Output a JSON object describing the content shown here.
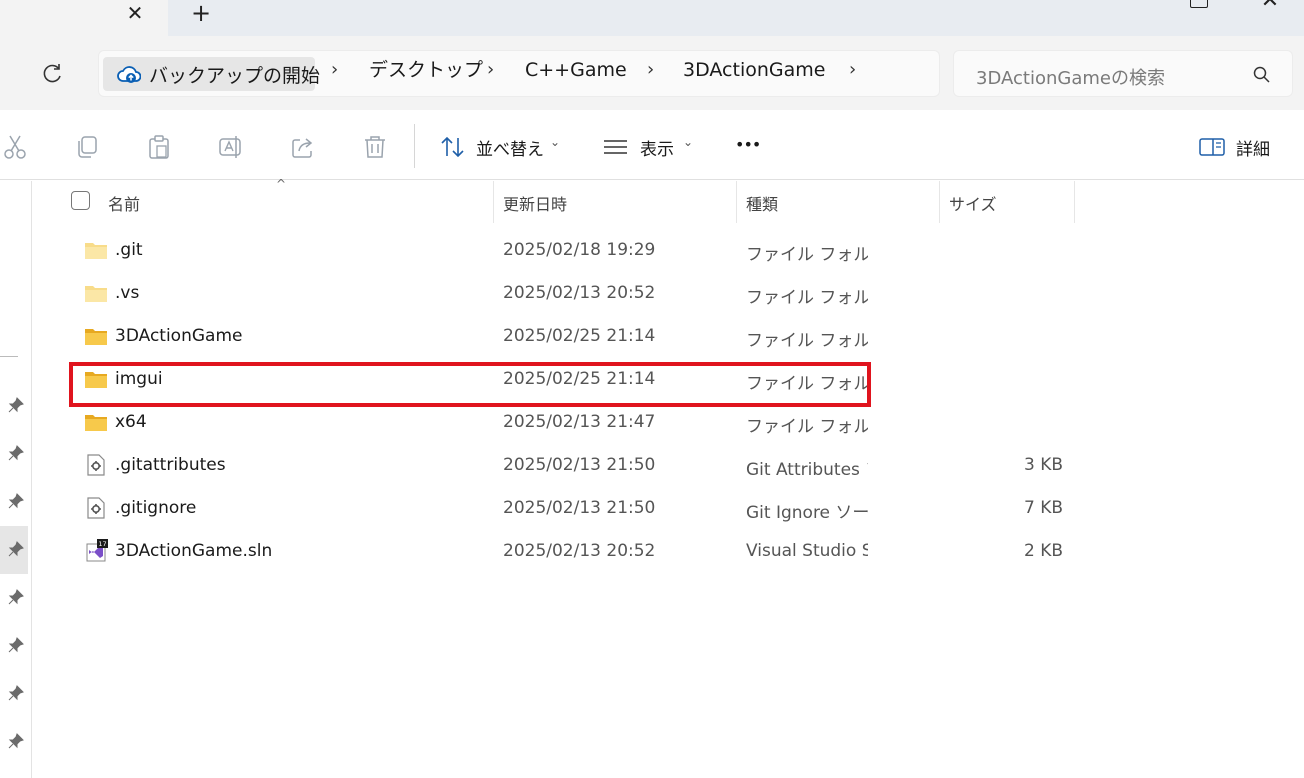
{
  "window": {
    "tab_close_glyph": "✕",
    "new_tab_glyph": "+",
    "close_glyph": "✕"
  },
  "address": {
    "breadcrumbs": [
      "バックアップの開始",
      "デスクトップ",
      "C++Game",
      "3DActionGame"
    ],
    "chevron": "›",
    "search_placeholder": "3DActionGameの検索"
  },
  "toolbar": {
    "sort_label": "並べ替え",
    "view_label": "表示",
    "more_label": "•••",
    "details_label": "詳細",
    "caret": "⌄"
  },
  "columns": {
    "name": "名前",
    "date": "更新日時",
    "type": "種類",
    "size": "サイズ"
  },
  "files": [
    {
      "name": ".git",
      "date": "2025/02/18 19:29",
      "type": "ファイル フォルダー",
      "size": "",
      "icon": "folder-faded-icon"
    },
    {
      "name": ".vs",
      "date": "2025/02/13 20:52",
      "type": "ファイル フォルダー",
      "size": "",
      "icon": "folder-faded-icon"
    },
    {
      "name": "3DActionGame",
      "date": "2025/02/25 21:14",
      "type": "ファイル フォルダー",
      "size": "",
      "icon": "folder-icon"
    },
    {
      "name": "imgui",
      "date": "2025/02/25 21:14",
      "type": "ファイル フォルダー",
      "size": "",
      "icon": "folder-icon"
    },
    {
      "name": "x64",
      "date": "2025/02/13 21:47",
      "type": "ファイル フォルダー",
      "size": "",
      "icon": "folder-icon"
    },
    {
      "name": ".gitattributes",
      "date": "2025/02/13 21:50",
      "type": "Git Attributes ソース フ...",
      "size": "3 KB",
      "icon": "settings-file-icon"
    },
    {
      "name": ".gitignore",
      "date": "2025/02/13 21:50",
      "type": "Git Ignore ソース ファイル",
      "size": "7 KB",
      "icon": "settings-file-icon"
    },
    {
      "name": "3DActionGame.sln",
      "date": "2025/02/13 20:52",
      "type": "Visual Studio Solution",
      "size": "2 KB",
      "icon": "visual-studio-solution-icon"
    }
  ],
  "solution_badge": "17",
  "colors": {
    "highlight": "#e0141e",
    "folder": "#f4c542",
    "folder_faded": "#f8dc8a"
  }
}
